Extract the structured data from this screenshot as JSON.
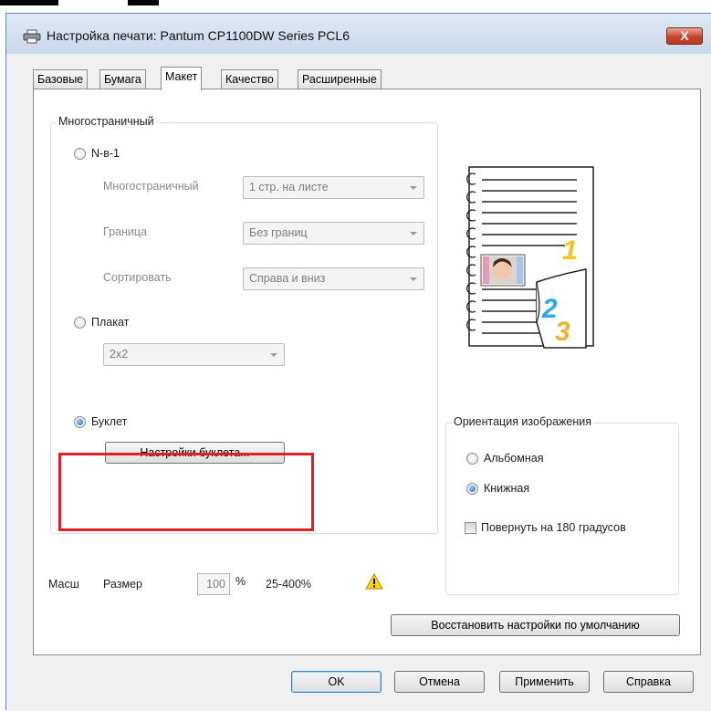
{
  "window": {
    "title": "Настройка печати: Pantum CP1100DW Series PCL6",
    "close_label": "X"
  },
  "tabs": [
    {
      "label": "Базовые",
      "active": false
    },
    {
      "label": "Бумага",
      "active": false
    },
    {
      "label": "Макет",
      "active": true
    },
    {
      "label": "Качество",
      "active": false
    },
    {
      "label": "Расширенные",
      "active": false
    }
  ],
  "multipage": {
    "title": "Многостраничный",
    "nup": {
      "label": "N-в-1",
      "selected": false,
      "multipage_label": "Многостраничный",
      "multipage_value": "1 стр. на листе",
      "border_label": "Граница",
      "border_value": "Без границ",
      "sort_label": "Сортировать",
      "sort_value": "Справа и вниз"
    },
    "poster": {
      "label": "Плакат",
      "selected": false,
      "value": "2x2"
    },
    "booklet": {
      "label": "Буклет",
      "selected": true,
      "settings_button": "Настройки буклета..."
    }
  },
  "scale": {
    "label": "Масш",
    "size_label": "Размер",
    "value": "100",
    "unit": "%",
    "range": "25-400%"
  },
  "orientation": {
    "title": "Ориентация изображения",
    "landscape": {
      "label": "Альбомная",
      "selected": false
    },
    "portrait": {
      "label": "Книжная",
      "selected": true
    },
    "rotate": {
      "label": "Повернуть на 180 градусов",
      "checked": false
    }
  },
  "preview": {
    "page_numbers": [
      "1",
      "2",
      "3"
    ]
  },
  "buttons": {
    "restore": "Восстановить настройки по умолчанию",
    "ok": "OK",
    "cancel": "Отмена",
    "apply": "Применить",
    "help": "Справка"
  },
  "colors": {
    "highlight": "#e21e26",
    "accent": "#1d66c8",
    "page1": "#f6c21c",
    "page2": "#2aa7e8",
    "page3": "#f3b12e"
  },
  "icons": {
    "title": "printer-icon",
    "warning": "warning-icon"
  }
}
